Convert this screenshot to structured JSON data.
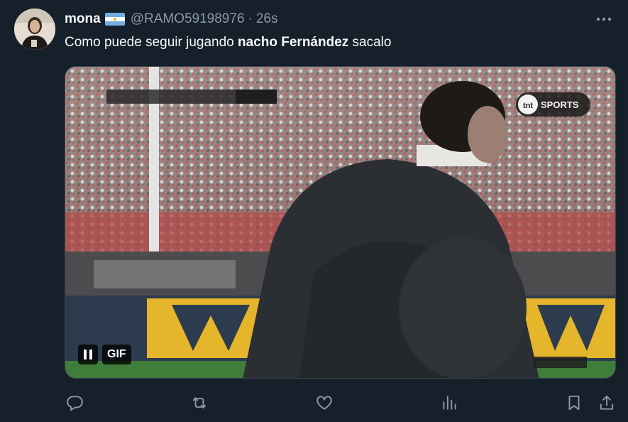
{
  "tweet": {
    "display_name": "mona",
    "flag_icon": "argentina-flag-icon",
    "handle": "@RAMO59198976",
    "separator": "·",
    "time": "26s",
    "text_before": "Como puede seguir jugando ",
    "text_bold": "nacho Fernández",
    "text_after": " sacalo"
  },
  "media": {
    "type": "GIF",
    "gif_label": "GIF",
    "scoreboard_text": "",
    "broadcaster": "TNT SPORTS"
  },
  "actions": {
    "reply_icon": "reply-icon",
    "retweet_icon": "retweet-icon",
    "like_icon": "heart-icon",
    "views_icon": "views-icon",
    "bookmark_icon": "bookmark-icon",
    "share_icon": "share-icon"
  },
  "colors": {
    "background": "#15202b",
    "primary_text": "#f7f9f9",
    "secondary_text": "#8b98a5",
    "border": "#38444d"
  }
}
